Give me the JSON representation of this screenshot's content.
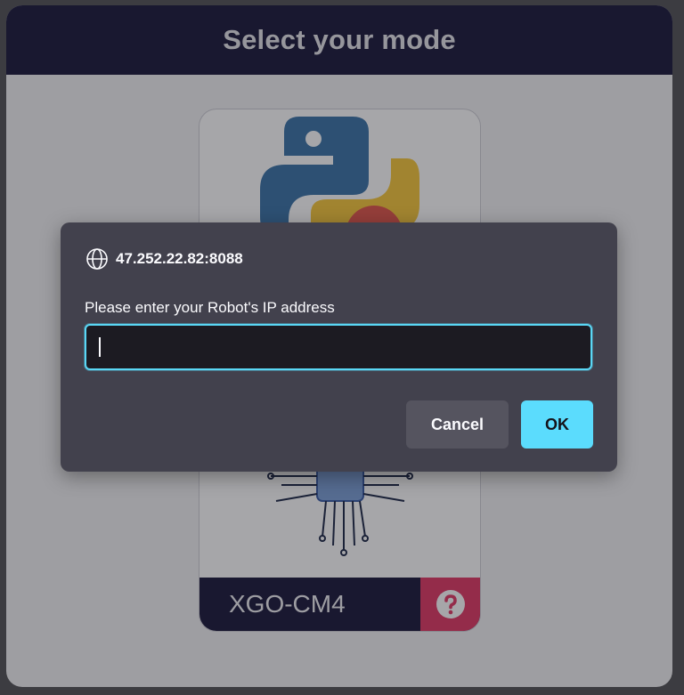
{
  "mode_panel": {
    "title": "Select your mode",
    "card": {
      "name": "XGO-CM4",
      "art_icons": [
        "python-logo-icon",
        "chip-circuit-icon"
      ],
      "help_icon": "question-circle-icon"
    }
  },
  "dialog": {
    "origin": "47.252.22.82:8088",
    "origin_icon": "globe-icon",
    "prompt": "Please enter your Robot's IP address",
    "input_value": "",
    "cancel_label": "Cancel",
    "ok_label": "OK"
  },
  "colors": {
    "header_bg": "#1c1a3c",
    "accent_cyan": "#5bdcfd",
    "help_red": "#e23a66",
    "dialog_bg": "#42414d"
  }
}
